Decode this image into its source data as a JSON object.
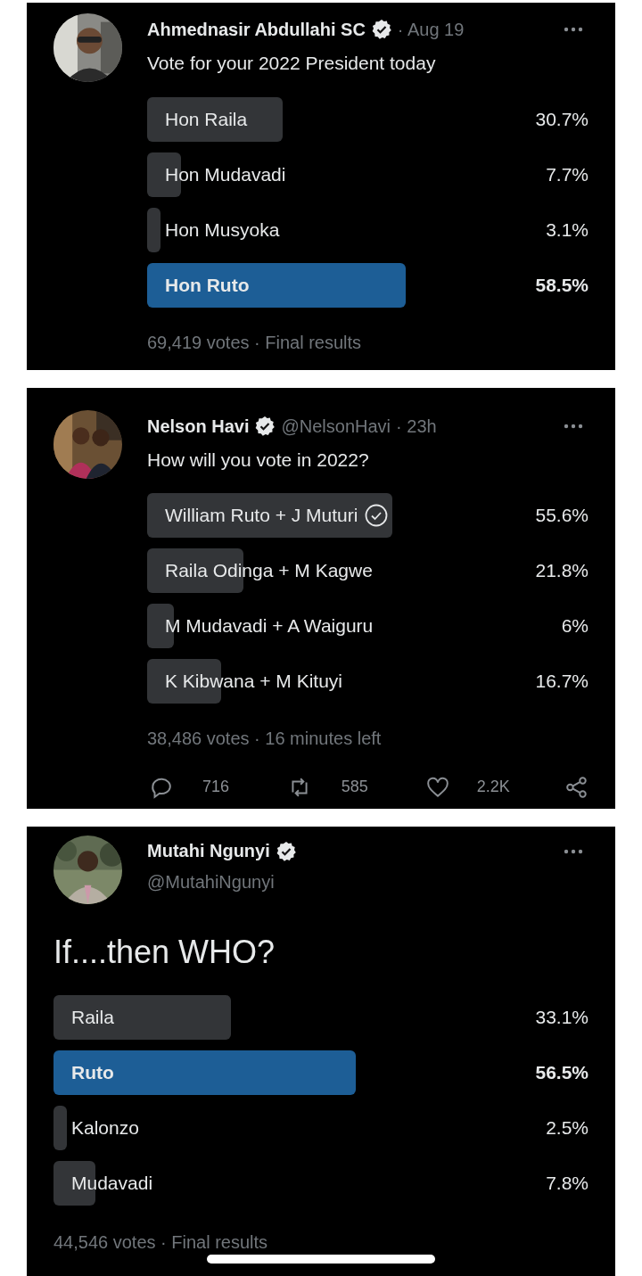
{
  "tweets": [
    {
      "kind": "compact",
      "author": {
        "name": "Ahmednasir Abdullahi SC",
        "verified": true,
        "time": "· Aug 19"
      },
      "text": "Vote for your 2022 President today",
      "poll": {
        "options": [
          {
            "label": "Hon Raila",
            "percent": "30.7%",
            "level": 0.307,
            "winner": false,
            "voted": false
          },
          {
            "label": "Hon Mudavadi",
            "percent": "7.7%",
            "level": 0.077,
            "winner": false,
            "voted": false
          },
          {
            "label": "Hon Musyoka",
            "percent": "3.1%",
            "level": 0.031,
            "winner": false,
            "voted": false
          },
          {
            "label": "Hon Ruto",
            "percent": "58.5%",
            "level": 0.585,
            "winner": true,
            "voted": false
          }
        ],
        "footer": "69,419 votes · Final results"
      }
    },
    {
      "kind": "compact",
      "author": {
        "name": "Nelson Havi",
        "verified": true,
        "handle": "@NelsonHavi",
        "time": "· 23h"
      },
      "text": "How will you vote in 2022?",
      "poll": {
        "options": [
          {
            "label": "William Ruto + J Muturi",
            "percent": "55.6%",
            "level": 0.556,
            "winner": false,
            "voted": true
          },
          {
            "label": "Raila Odinga + M Kagwe",
            "percent": "21.8%",
            "level": 0.218,
            "winner": false,
            "voted": false
          },
          {
            "label": "M Mudavadi + A Waiguru",
            "percent": "6%",
            "level": 0.06,
            "winner": false,
            "voted": false
          },
          {
            "label": "K Kibwana + M Kituyi",
            "percent": "16.7%",
            "level": 0.167,
            "winner": false,
            "voted": false
          }
        ],
        "footer": "38,486 votes · 16 minutes left"
      },
      "actions": [
        {
          "kind": "reply",
          "count": "716"
        },
        {
          "kind": "retweet",
          "count": "585"
        },
        {
          "kind": "like",
          "count": "2.2K"
        },
        {
          "kind": "share"
        }
      ]
    },
    {
      "kind": "expanded",
      "author": {
        "name": "Mutahi Ngunyi",
        "verified": true,
        "handle": "@MutahiNgunyi"
      },
      "text": "If....then WHO?",
      "poll": {
        "options": [
          {
            "label": "Raila",
            "percent": "33.1%",
            "level": 0.331,
            "winner": false,
            "voted": false
          },
          {
            "label": "Ruto",
            "percent": "56.5%",
            "level": 0.565,
            "winner": true,
            "voted": false
          },
          {
            "label": "Kalonzo",
            "percent": "2.5%",
            "level": 0.025,
            "winner": false,
            "voted": false
          },
          {
            "label": "Mudavadi",
            "percent": "7.8%",
            "level": 0.078,
            "winner": false,
            "voted": false
          }
        ],
        "footer": "44,546 votes · Final results"
      }
    }
  ]
}
